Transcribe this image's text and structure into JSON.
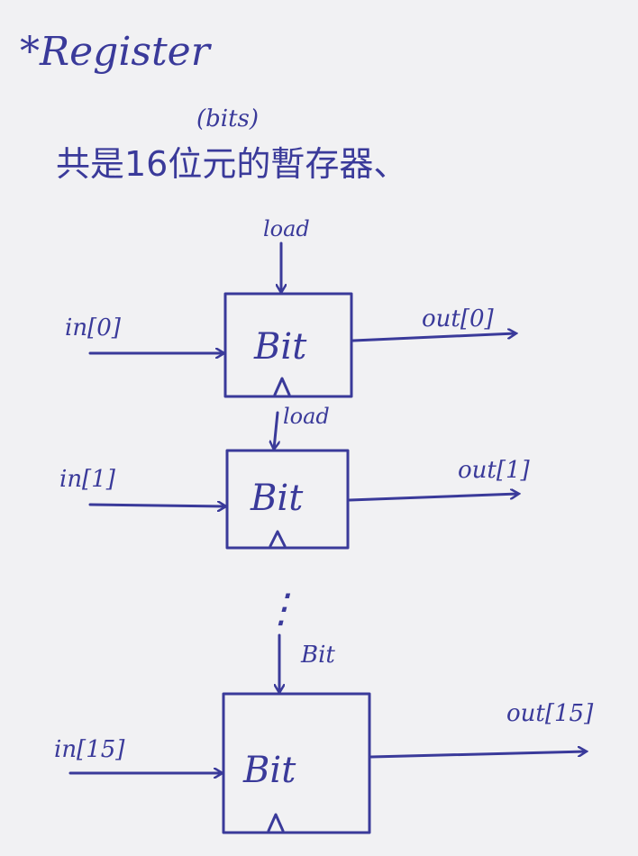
{
  "title": "*Register",
  "subtitle": "共是16位元的暫存器、",
  "subtitle_annotation": "(bits)",
  "blocks": [
    {
      "label": "Bit",
      "input": "in[0]",
      "output": "out[0]",
      "control": "load"
    },
    {
      "label": "Bit",
      "input": "in[1]",
      "output": "out[1]",
      "control": "load"
    },
    {
      "label": "Bit",
      "input": "in[15]",
      "output": "out[15]",
      "control": "Bit"
    }
  ],
  "ellipsis": "⋮",
  "colors": {
    "ink": "#3a3a9a",
    "paper": "#f1f1f3"
  }
}
